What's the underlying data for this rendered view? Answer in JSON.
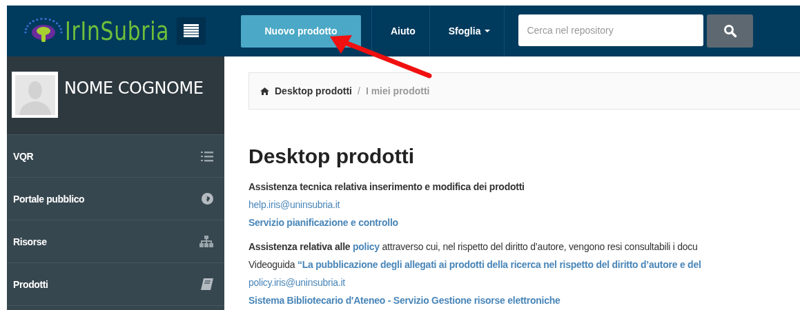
{
  "header": {
    "logo_text": "IrInSubria",
    "new_button": "Nuovo prodotto",
    "nav": [
      {
        "label": "Aiuto",
        "dropdown": false
      },
      {
        "label": "Sfoglia",
        "dropdown": true
      }
    ],
    "search": {
      "placeholder": "Cerca nel repository"
    }
  },
  "sidebar": {
    "user_name": "NOME COGNOME",
    "items": [
      {
        "label": "VQR"
      },
      {
        "label": "Portale pubblico"
      },
      {
        "label": "Risorse"
      },
      {
        "label": "Prodotti"
      }
    ]
  },
  "breadcrumb_separator": "/",
  "breadcrumb": [
    {
      "label": "Desktop prodotti",
      "current": false
    },
    {
      "label": "I miei prodotti",
      "current": true
    }
  ],
  "heading": "Desktop prodotti",
  "sections": [
    {
      "lines": [
        [
          {
            "kind": "strong",
            "text": "Assistenza tecnica relativa inserimento e modifica dei prodotti"
          }
        ],
        [
          {
            "kind": "link",
            "text": "help.iris@uninsubria.it"
          }
        ],
        [
          {
            "kind": "link-strong",
            "text": "Servizio pianificazione e controllo"
          }
        ]
      ]
    },
    {
      "lines": [
        [
          {
            "kind": "strong",
            "text": "Assistenza relativa alle "
          },
          {
            "kind": "link-strong",
            "text": "policy"
          },
          {
            "kind": "text",
            "text": " attraverso cui, nel rispetto del diritto d’autore, vengono resi consultabili i docu"
          }
        ],
        [
          {
            "kind": "text",
            "text": "Videoguida "
          },
          {
            "kind": "link-strong",
            "text": "“La pubblicazione degli allegati ai prodotti della ricerca nel rispetto del diritto d’autore e del"
          }
        ],
        [
          {
            "kind": "link",
            "text": "policy.iris@uninsubria.it"
          }
        ],
        [
          {
            "kind": "link-strong",
            "text": "Sistema Bibliotecario d'Ateneo - Servizio Gestione risorse elettroniche"
          }
        ]
      ]
    }
  ]
}
